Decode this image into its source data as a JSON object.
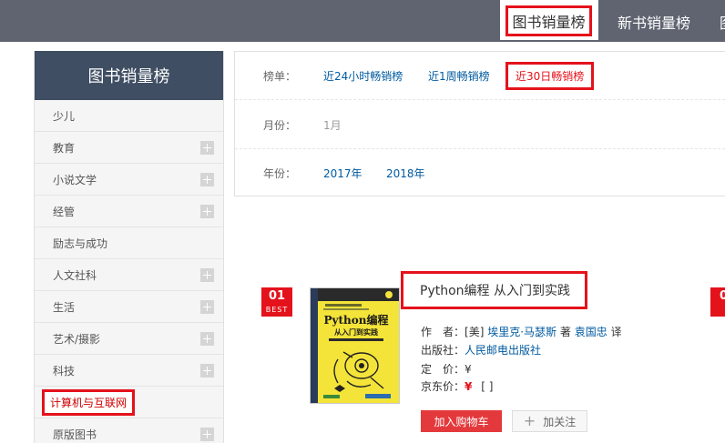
{
  "topnav": {
    "active": "图书销量榜",
    "items": [
      "新书销量榜",
      "图"
    ]
  },
  "sidebar": {
    "title": "图书销量榜",
    "items": [
      {
        "label": "少儿",
        "expandable": false
      },
      {
        "label": "教育",
        "expandable": true
      },
      {
        "label": "小说文学",
        "expandable": true
      },
      {
        "label": "经管",
        "expandable": true
      },
      {
        "label": "励志与成功",
        "expandable": false
      },
      {
        "label": "人文社科",
        "expandable": true
      },
      {
        "label": "生活",
        "expandable": true
      },
      {
        "label": "艺术/摄影",
        "expandable": true
      },
      {
        "label": "科技",
        "expandable": true
      },
      {
        "label": "计算机与互联网",
        "expandable": false,
        "highlighted": true
      },
      {
        "label": "原版图书",
        "expandable": true
      }
    ]
  },
  "filters": {
    "list_label": "榜单：",
    "list_options": [
      "近24小时畅销榜",
      "近1周畅销榜",
      "近30日畅销榜"
    ],
    "list_selected": "近30日畅销榜",
    "month_label": "月份：",
    "month_value": "1月",
    "year_label": "年份：",
    "year_options": [
      "2017年",
      "2018年"
    ]
  },
  "book": {
    "rank": "01",
    "rank_badge": "BEST",
    "next_rank": "0",
    "title": "Python编程 从入门到实践",
    "cover_title": "Python编程",
    "cover_subtitle": "从入门到实践",
    "author_label": "作　者：",
    "author_prefix": "[美]",
    "author": "埃里克·马瑟斯",
    "author_role": "著",
    "translator": "袁国忠",
    "translator_role": "译",
    "publisher_label": "出版社：",
    "publisher": "人民邮电出版社",
    "list_price_label": "定　价：",
    "list_price": "¥",
    "jd_price_label": "京东价：",
    "jd_price": "¥",
    "jd_price_bracket": "[ ]",
    "add_to_cart": "加入购物车",
    "follow": "加关注"
  },
  "colors": {
    "topbar": "#5f6470",
    "sidebar_header": "#3f4e63",
    "accent_red": "#e4121b",
    "link_blue": "#005aa0",
    "cover_yellow": "#f4e43a"
  }
}
